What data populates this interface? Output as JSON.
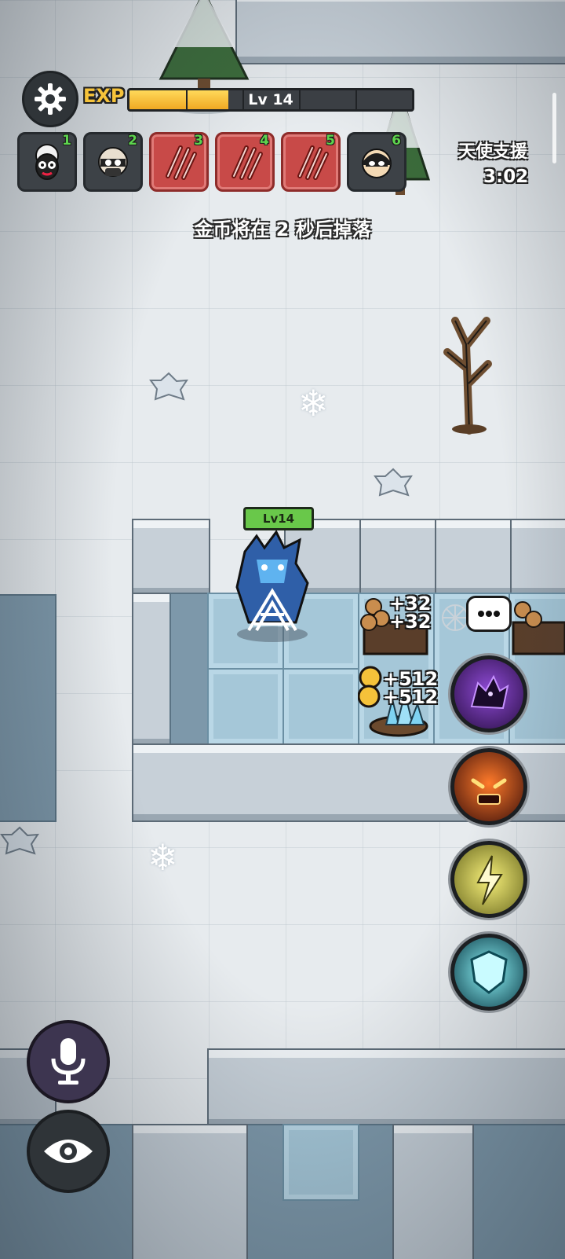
{
  "hud": {
    "exp_label": "EXP",
    "exp_progress": 0.35,
    "level_text": "Lv 14",
    "settings_icon": "gear-icon"
  },
  "slots": [
    {
      "num": "1",
      "icon": "sheep-face-icon",
      "state": "normal"
    },
    {
      "num": "2",
      "icon": "masked-sheep-icon",
      "state": "normal"
    },
    {
      "num": "3",
      "icon": "claw-slash-icon",
      "state": "red"
    },
    {
      "num": "4",
      "icon": "claw-slash-icon",
      "state": "red"
    },
    {
      "num": "5",
      "icon": "claw-slash-icon",
      "state": "red"
    },
    {
      "num": "6",
      "icon": "masked-hero-icon",
      "state": "normal"
    }
  ],
  "support": {
    "title": "天使支援",
    "time": "3:02"
  },
  "notice": "金币将在 2 秒后掉落",
  "player": {
    "level_tag": "Lv14"
  },
  "floaters": {
    "wood_1": "+32",
    "wood_2": "+32",
    "gold_1": "+512",
    "gold_2": "+512"
  },
  "skills": [
    "dark-wolf-icon",
    "fire-demon-icon",
    "lightning-icon",
    "ice-shield-icon"
  ],
  "buttons": {
    "voice": "microphone-icon",
    "view": "eye-icon",
    "chat": "chat-bubble-icon"
  },
  "colors": {
    "exp_fill": "#f0a923",
    "slot_red": "#c84a48",
    "level_tag": "#69c84a",
    "slot_number": "#5dd44e"
  }
}
